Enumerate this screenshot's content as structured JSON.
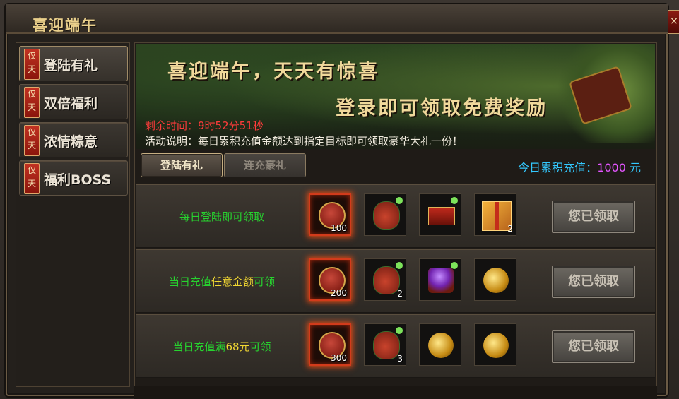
{
  "window": {
    "title": "喜迎端午",
    "close_glyph": "×"
  },
  "sidebar": {
    "items": [
      {
        "tag": "仅天",
        "label": "登陆有礼"
      },
      {
        "tag": "仅天",
        "label": "双倍福利"
      },
      {
        "tag": "仅天",
        "label": "浓情粽意"
      },
      {
        "tag": "仅天",
        "label": "福利BOSS"
      }
    ]
  },
  "banner": {
    "headline": "喜迎端午，天天有惊喜",
    "subheadline": "登录即可领取免费奖励",
    "remaining_time": "剩余时间：9时52分51秒",
    "description": "活动说明：每日累积充值金额达到指定目标即可领取豪华大礼一份！"
  },
  "tabs": [
    {
      "label": "登陆有礼"
    },
    {
      "label": "连充豪礼"
    }
  ],
  "today_recharge": {
    "label": "今日累积充值：",
    "amount": "1000",
    "unit": " 元"
  },
  "rows": [
    {
      "label_prefix": "每日登陆即可领取",
      "label_highlight": "",
      "label_suffix": "",
      "items": [
        {
          "icon": "medal-icon",
          "qty": "100"
        },
        {
          "icon": "bag-icon",
          "qty": ""
        },
        {
          "icon": "chest-icon",
          "qty": ""
        },
        {
          "icon": "gift-icon",
          "qty": "2"
        }
      ],
      "button": "您已领取"
    },
    {
      "label_prefix": "当日充值",
      "label_highlight": "任意金额",
      "label_suffix": "可领",
      "items": [
        {
          "icon": "medal-icon",
          "qty": "200"
        },
        {
          "icon": "bag-icon",
          "qty": "2"
        },
        {
          "icon": "treasure-box-icon",
          "qty": ""
        },
        {
          "icon": "gold-ornament-icon",
          "qty": ""
        }
      ],
      "button": "您已领取"
    },
    {
      "label_prefix": "当日充值满",
      "label_highlight": "68元",
      "label_suffix": "可领",
      "items": [
        {
          "icon": "medal-icon",
          "qty": "300"
        },
        {
          "icon": "bag-icon",
          "qty": "3"
        },
        {
          "icon": "gold-orb-icon",
          "qty": ""
        },
        {
          "icon": "gold-crystal-icon",
          "qty": ""
        }
      ],
      "button": "您已领取"
    }
  ],
  "colors": {
    "title": "#e9cf8b",
    "remaining": "#ff3b3b",
    "row_label": "#27d32f",
    "row_highlight": "#f2d832",
    "recharge_label": "#33c9ff",
    "recharge_amount": "#e455ff"
  }
}
